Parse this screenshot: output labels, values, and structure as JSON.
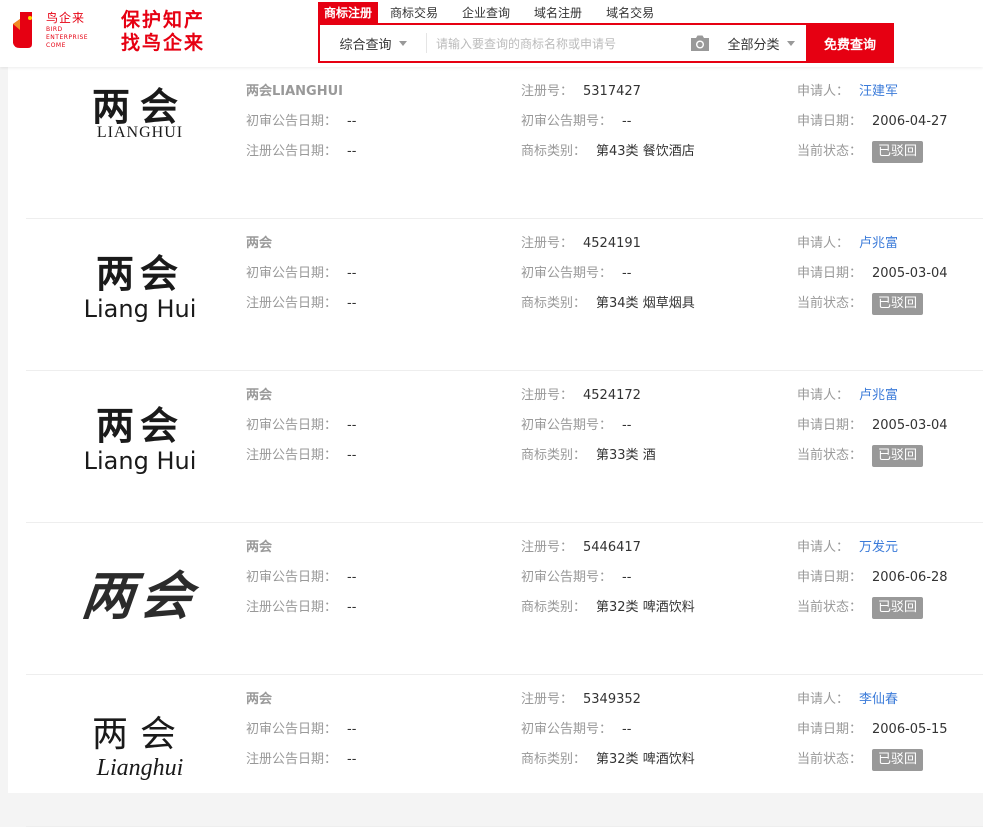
{
  "brand": {
    "logo_cn": "鸟企来",
    "logo_en": "BIRD ENTERPRISE COME",
    "slogan_line1": "保护知产",
    "slogan_line2": "找鸟企来",
    "color": "#e60012"
  },
  "nav": {
    "tabs": [
      {
        "label": "商标注册",
        "active": true
      },
      {
        "label": "商标交易",
        "active": false
      },
      {
        "label": "企业查询",
        "active": false
      },
      {
        "label": "域名注册",
        "active": false
      },
      {
        "label": "域名交易",
        "active": false
      }
    ]
  },
  "search": {
    "type": "综合查询",
    "placeholder": "请输入要查询的商标名称或申请号",
    "category": "全部分类",
    "button": "免费查询",
    "camera_icon": "camera-icon"
  },
  "labels": {
    "first_trial_date": "初审公告日期：",
    "reg_pub_date": "注册公告日期：",
    "reg_no": "注册号：",
    "first_trial_no": "初审公告期号：",
    "category": "商标类别：",
    "applicant": "申请人：",
    "apply_date": "申请日期：",
    "status": "当前状态："
  },
  "results": [
    {
      "mark_cn": "两会",
      "mark_en": "LIANGHUI",
      "name": "两会LIANGHUI",
      "first_trial_date": "--",
      "reg_pub_date": "--",
      "reg_no": "5317427",
      "first_trial_no": "--",
      "category": "第43类 餐饮酒店",
      "applicant": "汪建军",
      "apply_date": "2006-04-27",
      "status": "已驳回"
    },
    {
      "mark_cn": "两会",
      "mark_en": "Liang Hui",
      "name": "两会",
      "first_trial_date": "--",
      "reg_pub_date": "--",
      "reg_no": "4524191",
      "first_trial_no": "--",
      "category": "第34类 烟草烟具",
      "applicant": "卢兆富",
      "apply_date": "2005-03-04",
      "status": "已驳回"
    },
    {
      "mark_cn": "两会",
      "mark_en": "Liang Hui",
      "name": "两会",
      "first_trial_date": "--",
      "reg_pub_date": "--",
      "reg_no": "4524172",
      "first_trial_no": "--",
      "category": "第33类 酒",
      "applicant": "卢兆富",
      "apply_date": "2005-03-04",
      "status": "已驳回"
    },
    {
      "mark_cn": "两会",
      "mark_en": "",
      "name": "两会",
      "first_trial_date": "--",
      "reg_pub_date": "--",
      "reg_no": "5446417",
      "first_trial_no": "--",
      "category": "第32类 啤酒饮料",
      "applicant": "万发元",
      "apply_date": "2006-06-28",
      "status": "已驳回"
    },
    {
      "mark_cn": "两会",
      "mark_en": "Lianghui",
      "name": "两会",
      "first_trial_date": "--",
      "reg_pub_date": "--",
      "reg_no": "5349352",
      "first_trial_no": "--",
      "category": "第32类 啤酒饮料",
      "applicant": "李仙春",
      "apply_date": "2006-05-15",
      "status": "已驳回"
    }
  ]
}
